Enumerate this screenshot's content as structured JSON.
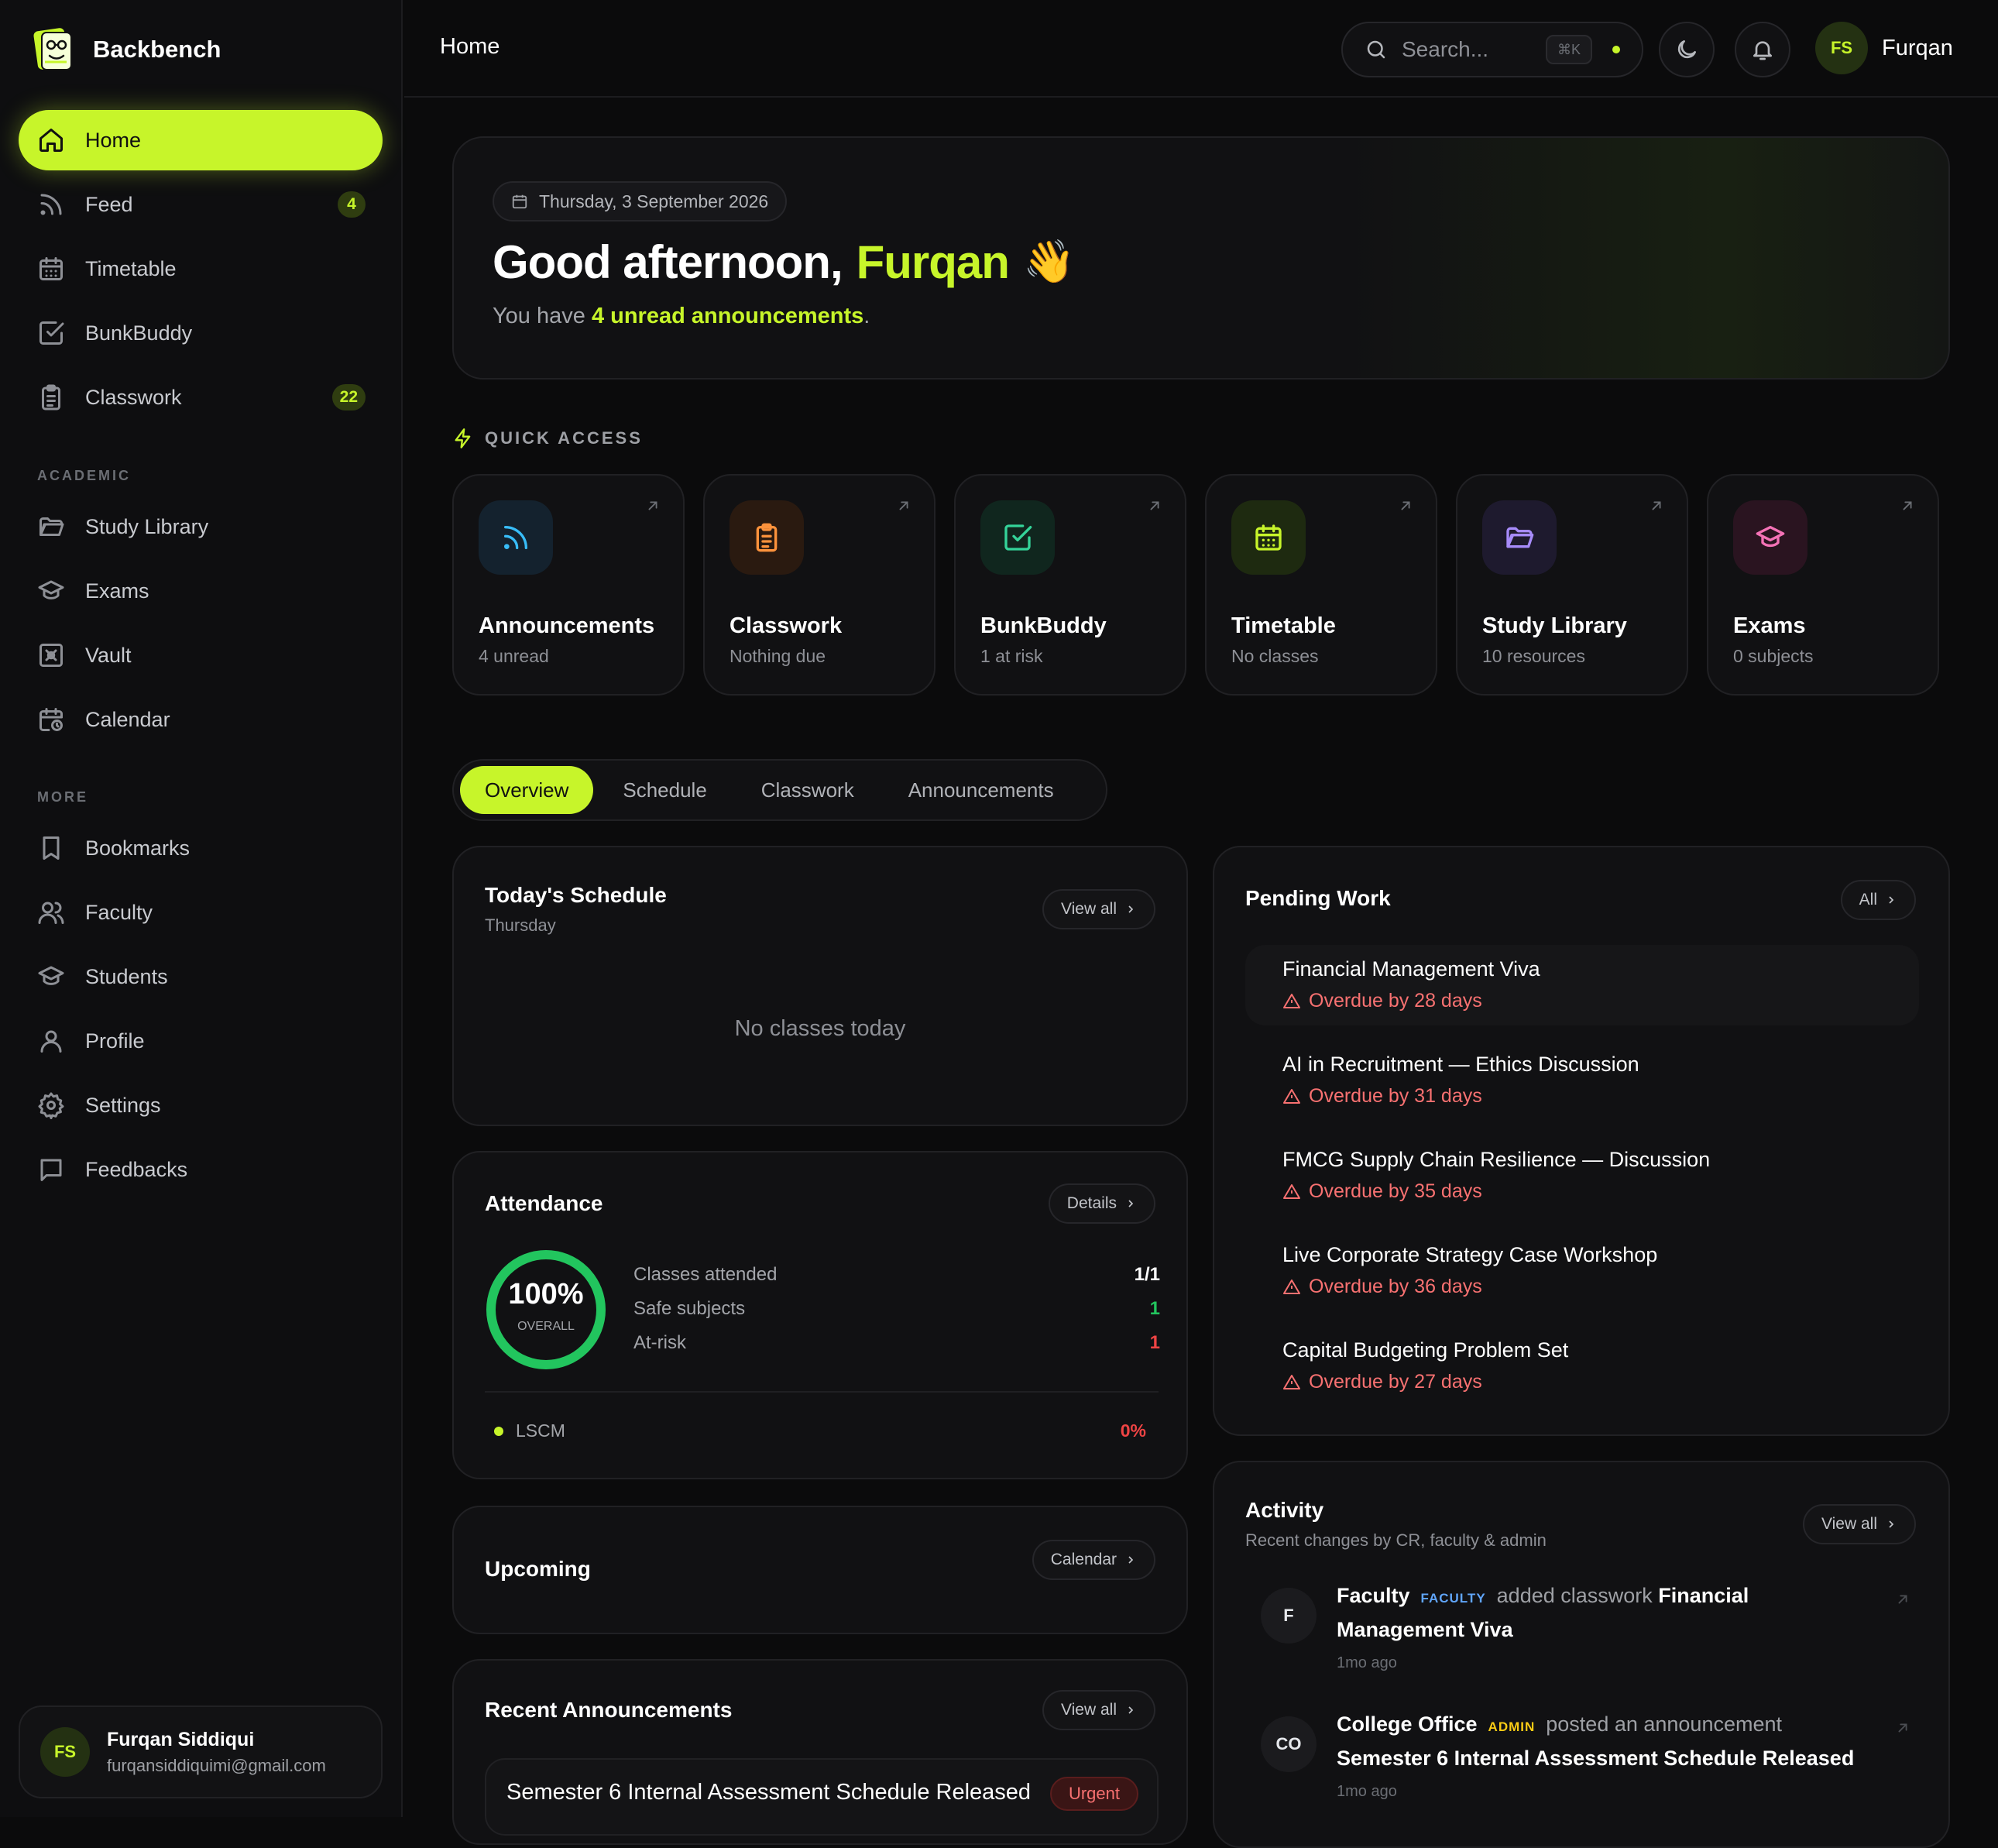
{
  "brand": {
    "name": "Backbench"
  },
  "sidebar": {
    "main": [
      {
        "label": "Home",
        "icon": "home-icon",
        "active": true
      },
      {
        "label": "Feed",
        "icon": "rss-icon",
        "badge": "4"
      },
      {
        "label": "Timetable",
        "icon": "calendar-grid-icon"
      },
      {
        "label": "BunkBuddy",
        "icon": "check-square-icon"
      },
      {
        "label": "Classwork",
        "icon": "clipboard-icon",
        "badge": "22"
      }
    ],
    "academic_label": "ACADEMIC",
    "academic": [
      {
        "label": "Study Library",
        "icon": "folder-open-icon"
      },
      {
        "label": "Exams",
        "icon": "graduation-cap-icon"
      },
      {
        "label": "Vault",
        "icon": "vault-icon"
      },
      {
        "label": "Calendar",
        "icon": "calendar-clock-icon"
      }
    ],
    "more_label": "MORE",
    "more": [
      {
        "label": "Bookmarks",
        "icon": "bookmark-icon"
      },
      {
        "label": "Faculty",
        "icon": "users-icon"
      },
      {
        "label": "Students",
        "icon": "graduation-cap-icon"
      },
      {
        "label": "Profile",
        "icon": "user-icon"
      },
      {
        "label": "Settings",
        "icon": "gear-icon"
      },
      {
        "label": "Feedbacks",
        "icon": "message-square-icon"
      }
    ],
    "user": {
      "initials": "FS",
      "name": "Furqan Siddiqui",
      "email": "furqansiddiquimi@gmail.com"
    }
  },
  "topbar": {
    "title": "Home",
    "search_placeholder": "Search...",
    "shortcut": "⌘K",
    "user_initials": "FS",
    "user_name": "Furqan"
  },
  "hero": {
    "date": "Thursday, 3 September 2026",
    "greeting": "Good afternoon,",
    "name": "Furqan",
    "emoji": "👋",
    "sub_before": "You have ",
    "sub_highlight": "4 unread announcements",
    "sub_after": "."
  },
  "quick_access": {
    "label": "QUICK ACCESS",
    "cards": [
      {
        "title": "Announcements",
        "sub": "4 unread",
        "icon": "rss-icon",
        "color": "#38bdf8",
        "bg": "#14222e"
      },
      {
        "title": "Classwork",
        "sub": "Nothing due",
        "icon": "clipboard-icon",
        "color": "#fb923c",
        "bg": "#2a1a10"
      },
      {
        "title": "BunkBuddy",
        "sub": "1 at risk",
        "icon": "check-square-icon",
        "color": "#34d399",
        "bg": "#10261e"
      },
      {
        "title": "Timetable",
        "sub": "No classes",
        "icon": "calendar-grid-icon",
        "color": "#c7f52a",
        "bg": "#1e2a10"
      },
      {
        "title": "Study Library",
        "sub": "10 resources",
        "icon": "folder-open-icon",
        "color": "#a78bfa",
        "bg": "#1e1a2e"
      },
      {
        "title": "Exams",
        "sub": "0 subjects",
        "icon": "graduation-cap-icon",
        "color": "#f472b6",
        "bg": "#2a1420"
      }
    ]
  },
  "tabs": [
    {
      "label": "Overview",
      "active": true
    },
    {
      "label": "Schedule"
    },
    {
      "label": "Classwork"
    },
    {
      "label": "Announcements"
    }
  ],
  "schedule": {
    "title": "Today's Schedule",
    "sub": "Thursday",
    "button": "View all",
    "empty": "No classes today"
  },
  "attendance": {
    "title": "Attendance",
    "button": "Details",
    "percent": "100%",
    "percent_value": 100,
    "overall": "OVERALL",
    "rows": [
      {
        "label": "Classes attended",
        "value": "1/1",
        "color": "#ffffff"
      },
      {
        "label": "Safe subjects",
        "value": "1",
        "color": "#22c55e"
      },
      {
        "label": "At-risk",
        "value": "1",
        "color": "#ef4444"
      }
    ],
    "subject": {
      "name": "LSCM",
      "value": "0%"
    }
  },
  "upcoming": {
    "title": "Upcoming",
    "button": "Calendar"
  },
  "recent_announcements": {
    "title": "Recent Announcements",
    "button": "View all",
    "items": [
      {
        "title": "Semester 6 Internal Assessment Schedule Released",
        "tag": "Urgent"
      }
    ]
  },
  "pending": {
    "title": "Pending Work",
    "button": "All",
    "items": [
      {
        "title": "Financial Management Viva",
        "status": "Overdue by 28 days"
      },
      {
        "title": "AI in Recruitment — Ethics Discussion",
        "status": "Overdue by 31 days"
      },
      {
        "title": "FMCG Supply Chain Resilience — Discussion",
        "status": "Overdue by 35 days"
      },
      {
        "title": "Live Corporate Strategy Case Workshop",
        "status": "Overdue by 36 days"
      },
      {
        "title": "Capital Budgeting Problem Set",
        "status": "Overdue by 27 days"
      }
    ]
  },
  "activity": {
    "title": "Activity",
    "sub": "Recent changes by CR, faculty & admin",
    "button": "View all",
    "items": [
      {
        "initials": "F",
        "actor": "Faculty",
        "role": "FACULTY",
        "role_color": "#60a5fa",
        "action": "added classwork",
        "target": "Financial Management Viva",
        "time": "1mo ago"
      },
      {
        "initials": "CO",
        "actor": "College Office",
        "role": "ADMIN",
        "role_color": "#facc15",
        "action": "posted an announcement",
        "target": "Semester 6 Internal Assessment Schedule Released",
        "time": "1mo ago"
      }
    ]
  }
}
